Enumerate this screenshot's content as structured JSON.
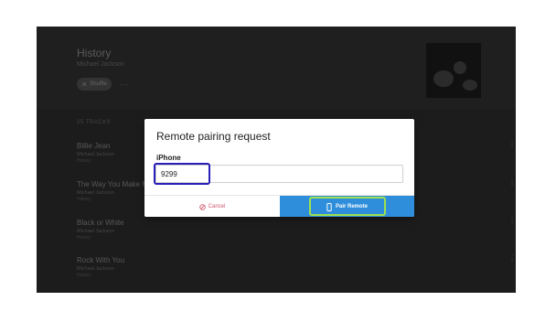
{
  "album": {
    "title": "History",
    "artist": "Michael Jackson",
    "shuffle_label": "Shuffle",
    "more_label": "···",
    "tracks_count": "25 TRACKS"
  },
  "tracks": [
    {
      "title": "Billie Jean",
      "artist": "Michael Jackson",
      "sub": "History"
    },
    {
      "title": "The Way You Make M",
      "artist": "Michael Jackson",
      "sub": "History"
    },
    {
      "title": "Black or White",
      "artist": "Michael Jackson",
      "sub": "History"
    },
    {
      "title": "Rock With You",
      "artist": "Michael Jackson",
      "sub": "History"
    }
  ],
  "dialog": {
    "title": "Remote pairing request",
    "device_label": "iPhone",
    "code_value": "9299",
    "cancel_label": "Cancel",
    "pair_label": "Pair Remote"
  },
  "colors": {
    "overlay_bg": "#1c1c1c",
    "pair_button": "#2f8edb",
    "cancel_text": "#d2566a",
    "input_highlight": "#2a1fb8",
    "button_highlight": "#9ee04e"
  },
  "icons": {
    "shuffle": "shuffle-icon",
    "cancel": "cancel-icon",
    "phone": "phone-icon",
    "track_menu": "more-vertical-icon"
  }
}
